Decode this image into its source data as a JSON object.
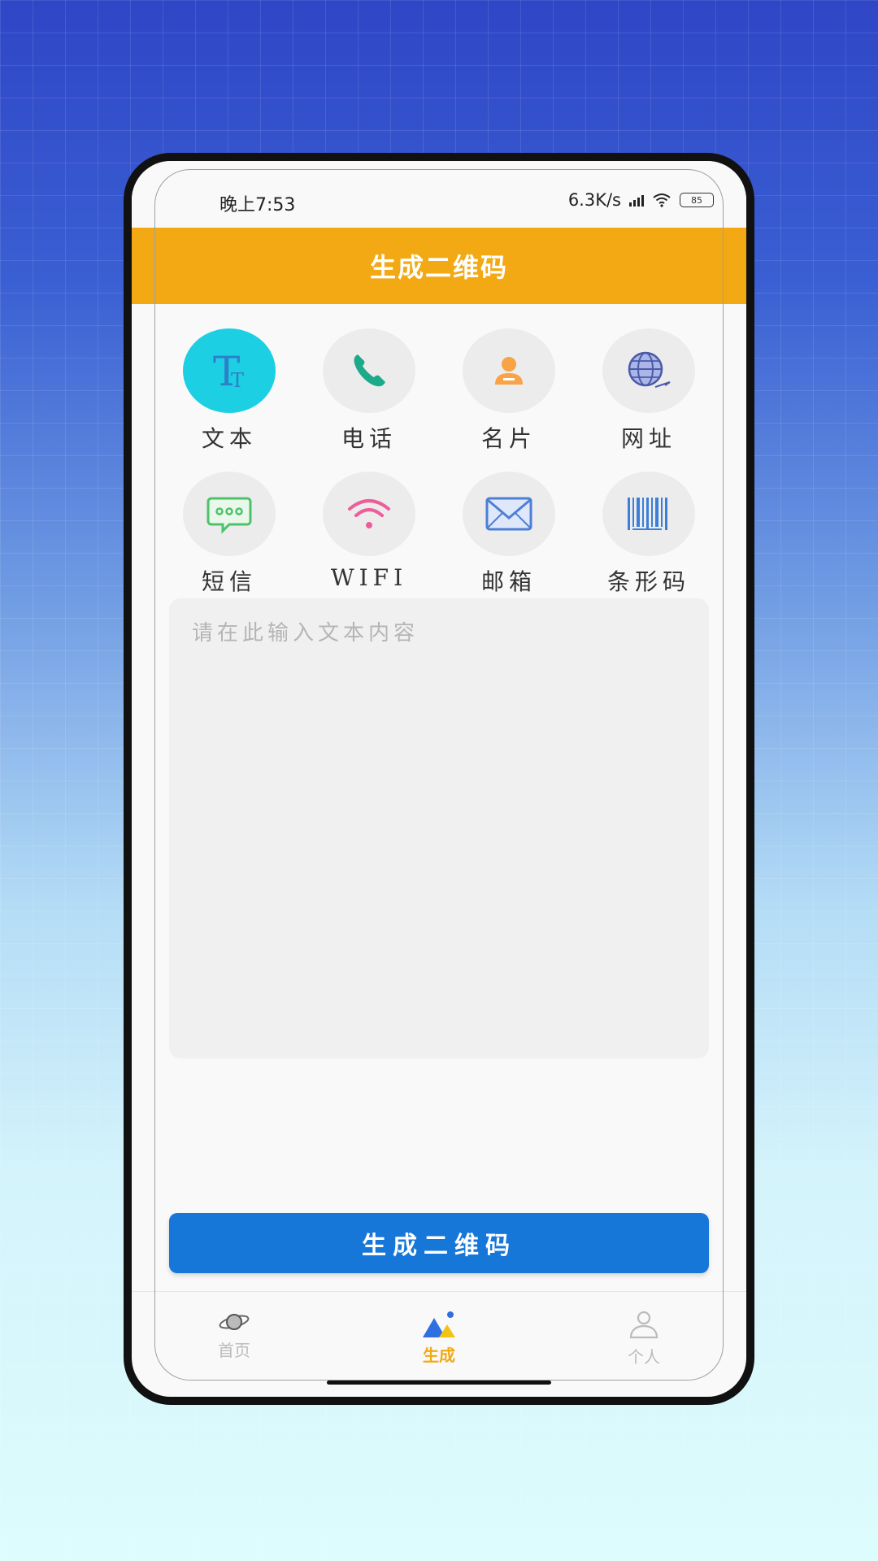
{
  "status_bar": {
    "time": "晚上7:53",
    "network_speed": "6.3K/s",
    "battery": "85"
  },
  "header": {
    "title": "生成二维码"
  },
  "types": [
    {
      "label": "文本",
      "icon": "text-icon",
      "active": true
    },
    {
      "label": "电话",
      "icon": "phone-icon",
      "active": false
    },
    {
      "label": "名片",
      "icon": "contact-card-icon",
      "active": false
    },
    {
      "label": "网址",
      "icon": "globe-icon",
      "active": false
    },
    {
      "label": "短信",
      "icon": "sms-icon",
      "active": false
    },
    {
      "label": "WIFI",
      "icon": "wifi-icon",
      "active": false
    },
    {
      "label": "邮箱",
      "icon": "mail-icon",
      "active": false
    },
    {
      "label": "条形码",
      "icon": "barcode-icon",
      "active": false
    }
  ],
  "input": {
    "placeholder": "请在此输入文本内容",
    "value": ""
  },
  "generate_button": {
    "label": "生成二维码"
  },
  "bottom_nav": [
    {
      "label": "首页",
      "icon": "planet-icon",
      "active": false
    },
    {
      "label": "生成",
      "icon": "generate-icon",
      "active": true
    },
    {
      "label": "个人",
      "icon": "person-icon",
      "active": false
    }
  ],
  "colors": {
    "accent": "#f2a913",
    "primary_button": "#1777d8",
    "active_type": "#1ccfe3"
  }
}
